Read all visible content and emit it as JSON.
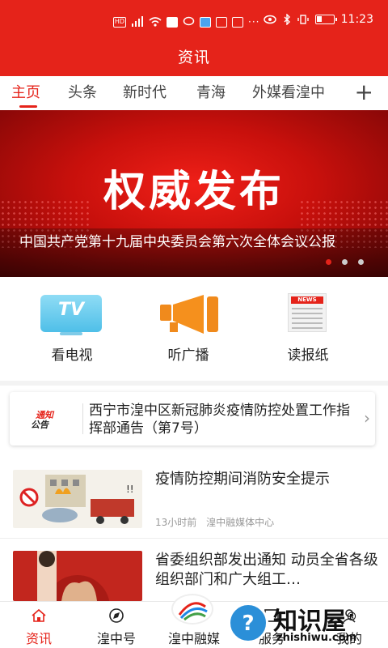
{
  "status_bar": {
    "left_icons": [
      "hd-icon",
      "signal-icon",
      "wifi-icon",
      "app-notification-icon",
      "chat-icon",
      "search-app-icon",
      "app-badge-icon",
      "app-badge-icon",
      "more-dots-icon"
    ],
    "right_icons": [
      "eye-icon",
      "bluetooth-icon",
      "vibrate-icon",
      "battery-icon"
    ],
    "time": "11:23"
  },
  "header": {
    "title": "资讯"
  },
  "tabs": [
    {
      "label": "主页",
      "active": true
    },
    {
      "label": "头条",
      "active": false
    },
    {
      "label": "新时代",
      "active": false
    },
    {
      "label": "青海",
      "active": false
    },
    {
      "label": "外媒看湟中",
      "active": false
    }
  ],
  "tabs_more_label": "+",
  "banner": {
    "headline": "权威发布",
    "caption": "中国共产党第十九届中央委员会第六次全体会议公报",
    "page_count": 3,
    "active_page": 1
  },
  "quick_entries": [
    {
      "label": "看电视",
      "icon": "tv-icon",
      "icon_text": "TV"
    },
    {
      "label": "听广播",
      "icon": "broadcast-horn-icon"
    },
    {
      "label": "读报纸",
      "icon": "newspaper-icon",
      "icon_text": "NEWS"
    }
  ],
  "notice": {
    "logo_line1": "通知",
    "logo_line2": "公告",
    "text": "西宁市湟中区新冠肺炎疫情防控处置工作指挥部通告（第7号）"
  },
  "news": [
    {
      "title": "疫情防控期间消防安全提示",
      "time": "13小时前",
      "source": "湟中融媒体中心"
    },
    {
      "title": "省委组织部发出通知  动员全省各级组织部门和广大组工…",
      "time": "",
      "source": ""
    }
  ],
  "bottom_nav": [
    {
      "label": "资讯",
      "icon": "home-icon",
      "active": true
    },
    {
      "label": "湟中号",
      "icon": "compass-icon",
      "active": false
    },
    {
      "label": "湟中融媒",
      "icon": "app-logo-icon",
      "active": false
    },
    {
      "label": "服务",
      "icon": "service-icon",
      "active": false
    },
    {
      "label": "我的",
      "icon": "profile-icon",
      "active": false
    }
  ],
  "watermark": {
    "text": "知识屋",
    "url": "zhishiwu.com",
    "mark": "®"
  },
  "colors": {
    "accent": "#e5231a",
    "header_bg": "#e5231a"
  }
}
